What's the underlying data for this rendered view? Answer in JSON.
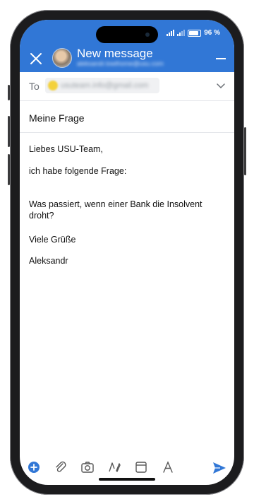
{
  "status": {
    "battery": "96 %"
  },
  "header": {
    "title": "New message",
    "from_address": "aleksandr.lowthome@usu.com"
  },
  "to": {
    "label": "To",
    "recipient": "usuteam.info@gmail.com"
  },
  "subject": "Meine Frage",
  "body": {
    "greeting": "Liebes USU-Team,",
    "intro": "ich habe folgende Frage:",
    "question": "Was passiert, wenn einer Bank die Insolvent droht?",
    "closing": "Viele Grüße",
    "signature": "Aleksandr"
  },
  "toolbar": {
    "icons": [
      "add-icon",
      "attach-icon",
      "camera-icon",
      "draw-icon",
      "calendar-icon",
      "format-text-icon",
      "send-icon"
    ]
  },
  "colors": {
    "accent": "#3177d6",
    "header_bg": "#3177d6"
  }
}
